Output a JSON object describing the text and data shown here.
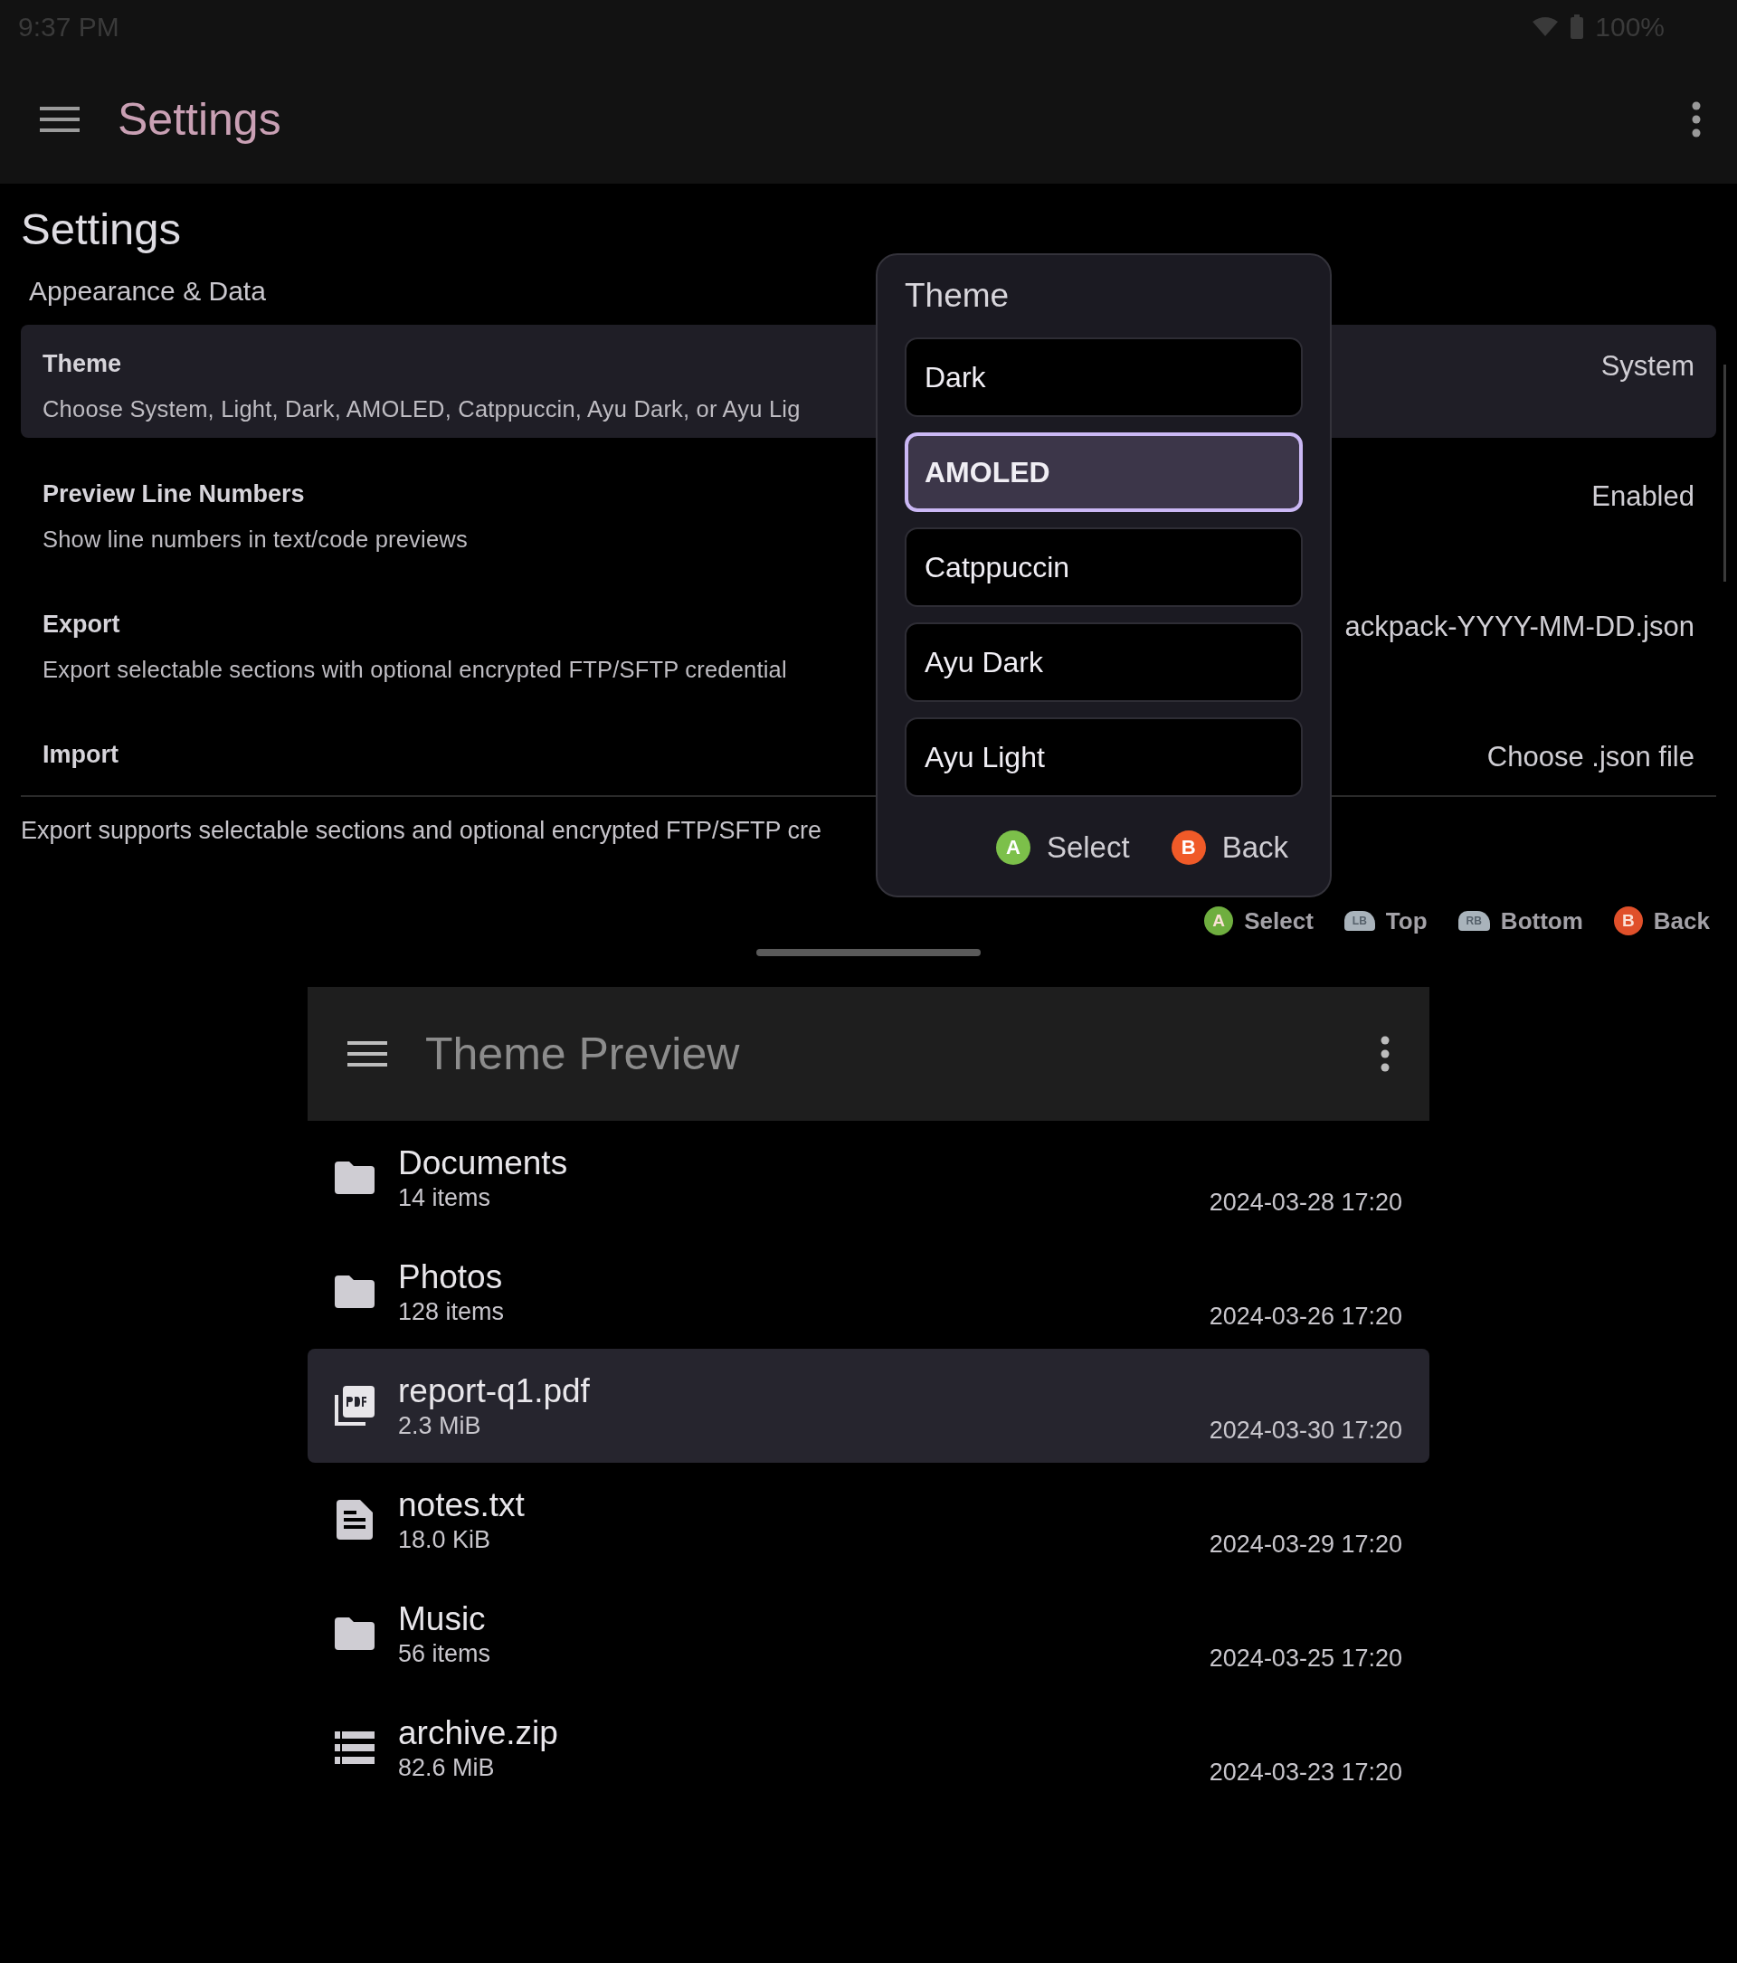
{
  "status_bar": {
    "time": "9:37 PM",
    "battery": "100%"
  },
  "app_bar": {
    "title": "Settings"
  },
  "page": {
    "heading": "Settings",
    "section": "Appearance & Data",
    "settings": [
      {
        "title": "Theme",
        "description": "Choose System, Light, Dark, AMOLED, Catppuccin, Ayu Dark, or Ayu Lig",
        "value": "System",
        "selected": true
      },
      {
        "title": "Preview Line Numbers",
        "description": "Show line numbers in text/code previews",
        "value": "Enabled",
        "selected": false
      },
      {
        "title": "Export",
        "description": "Export selectable sections with optional encrypted FTP/SFTP credential",
        "value": "ackpack-YYYY-MM-DD.json",
        "selected": false
      },
      {
        "title": "Import",
        "value": "Choose .json file",
        "selected": false
      }
    ],
    "footnote": "Export supports selectable sections and optional encrypted FTP/SFTP cre",
    "hints": [
      {
        "kind": "face",
        "key": "A",
        "label": "Select",
        "color": "#6fae3f"
      },
      {
        "kind": "shoulder",
        "key": "LB",
        "label": "Top"
      },
      {
        "kind": "shoulder",
        "key": "RB",
        "label": "Bottom"
      },
      {
        "kind": "face",
        "key": "B",
        "label": "Back",
        "color": "#e0502a"
      }
    ]
  },
  "dialog": {
    "title": "Theme",
    "options": [
      {
        "label": "Dark",
        "selected": false
      },
      {
        "label": "AMOLED",
        "selected": true
      },
      {
        "label": "Catppuccin",
        "selected": false
      },
      {
        "label": "Ayu Dark",
        "selected": false
      },
      {
        "label": "Ayu Light",
        "selected": false
      }
    ],
    "actions": [
      {
        "key": "A",
        "label": "Select",
        "color": "#7cc04a"
      },
      {
        "key": "B",
        "label": "Back",
        "color": "#f05a28"
      }
    ]
  },
  "preview": {
    "title": "Theme Preview",
    "files": [
      {
        "kind": "folder",
        "name": "Documents",
        "detail": "14 items",
        "date": "2024-03-28 17:20",
        "selected": false
      },
      {
        "kind": "folder",
        "name": "Photos",
        "detail": "128 items",
        "date": "2024-03-26 17:20",
        "selected": false
      },
      {
        "kind": "pdf",
        "name": "report-q1.pdf",
        "detail": "2.3 MiB",
        "date": "2024-03-30 17:20",
        "selected": true
      },
      {
        "kind": "text",
        "name": "notes.txt",
        "detail": "18.0 KiB",
        "date": "2024-03-29 17:20",
        "selected": false
      },
      {
        "kind": "folder",
        "name": "Music",
        "detail": "56 items",
        "date": "2024-03-25 17:20",
        "selected": false
      },
      {
        "kind": "archive",
        "name": "archive.zip",
        "detail": "82.6 MiB",
        "date": "2024-03-23 17:20",
        "selected": false
      }
    ]
  }
}
